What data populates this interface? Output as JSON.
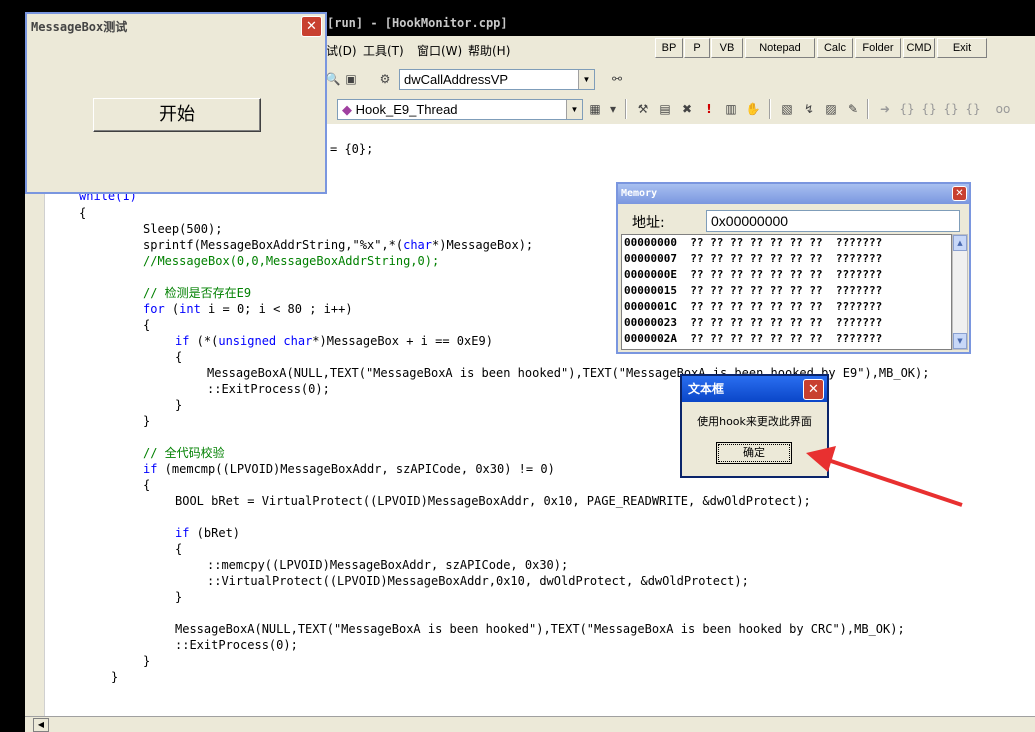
{
  "ide": {
    "title": "[run] - [HookMonitor.cpp]",
    "menu": [
      "试(D)",
      "工具(T)",
      "窗口(W)",
      "帮助(H)"
    ],
    "quick_buttons": [
      "BP",
      "P",
      "VB",
      "Notepad",
      "Calc",
      "Folder",
      "CMD",
      "Exit"
    ],
    "combo_var": "dwCallAddressVP",
    "combo_func": "Hook_E9_Thread",
    "code": [
      {
        "t": "= {0};"
      },
      {
        "t": "while(1)"
      },
      {
        "t": "{"
      },
      {
        "t": "Sleep(500);"
      },
      {
        "t": "sprintf(MessageBoxAddrString,\"%x\",*(char*)MessageBox);"
      },
      {
        "t": "//MessageBox(0,0,MessageBoxAddrString,0);"
      },
      {
        "t": "// 检测是否存在E9"
      },
      {
        "t": "for (int i = 0; i < 80 ; i++)"
      },
      {
        "t": "{"
      },
      {
        "t": "if (*(unsigned char*)MessageBox + i == 0xE9)"
      },
      {
        "t": "{"
      },
      {
        "t": "MessageBoxA(NULL,TEXT(\"MessageBoxA is been hooked\"),TEXT(\"MessageBoxA is been hooked by E9\"),MB_OK);"
      },
      {
        "t": "::ExitProcess(0);"
      },
      {
        "t": "}"
      },
      {
        "t": "}"
      },
      {
        "t": "// 全代码校验"
      },
      {
        "t": "if (memcmp((LPVOID)MessageBoxAddr, szAPICode, 0x30) != 0)"
      },
      {
        "t": "{"
      },
      {
        "t": "BOOL bRet = VirtualProtect((LPVOID)MessageBoxAddr, 0x10, PAGE_READWRITE, &dwOldProtect);"
      },
      {
        "t": "if (bRet)"
      },
      {
        "t": "{"
      },
      {
        "t": "::memcpy((LPVOID)MessageBoxAddr, szAPICode, 0x30);"
      },
      {
        "t": "::VirtualProtect((LPVOID)MessageBoxAddr,0x10, dwOldProtect, &dwOldProtect);"
      },
      {
        "t": "}"
      },
      {
        "t": "MessageBoxA(NULL,TEXT(\"MessageBoxA is been hooked\"),TEXT(\"MessageBoxA is been hooked by CRC\"),MB_OK);"
      },
      {
        "t": "::ExitProcess(0);"
      },
      {
        "t": "}"
      },
      {
        "t": "}"
      }
    ]
  },
  "msgbox_window": {
    "title": "MessageBox测试",
    "start_button": "开始"
  },
  "memory_window": {
    "title": "Memory",
    "address_label": "地址:",
    "address_value": "0x00000000",
    "rows": [
      "00000000  ?? ?? ?? ?? ?? ?? ??  ???????",
      "00000007  ?? ?? ?? ?? ?? ?? ??  ???????",
      "0000000E  ?? ?? ?? ?? ?? ?? ??  ???????",
      "00000015  ?? ?? ?? ?? ?? ?? ??  ???????",
      "0000001C  ?? ?? ?? ?? ?? ?? ??  ???????",
      "00000023  ?? ?? ?? ?? ?? ?? ??  ???????",
      "0000002A  ?? ?? ?? ?? ?? ?? ??  ???????"
    ]
  },
  "dialog": {
    "title": "文本框",
    "message": "使用hook来更改此界面",
    "ok_button": "确定"
  },
  "annotation": {
    "arrow_color": "#e83030"
  }
}
